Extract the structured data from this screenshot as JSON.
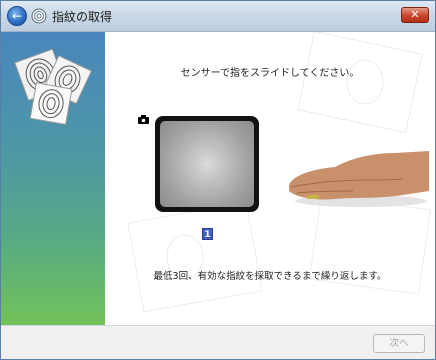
{
  "window": {
    "title": "指紋の取得",
    "close_symbol": "✕",
    "back_symbol": "←"
  },
  "content": {
    "instruction": "センサーで指をスライドしてください。",
    "count_badge": "1",
    "hint": "最低3回、有効な指紋を採取できるまで繰り返します。"
  },
  "footer": {
    "next_label": "次へ",
    "next_enabled": false
  },
  "icons": {
    "back": "back-arrow-icon",
    "title": "fingerprint-icon",
    "close": "close-icon",
    "camera": "camera-icon",
    "sidebar": "fingerprint-cards-logo"
  },
  "colors": {
    "titlebar": "#cbd9e7",
    "sidebar_top": "#4a86bd",
    "sidebar_bottom": "#73c25a",
    "close": "#c9432c",
    "badge": "#3f5fc3"
  }
}
